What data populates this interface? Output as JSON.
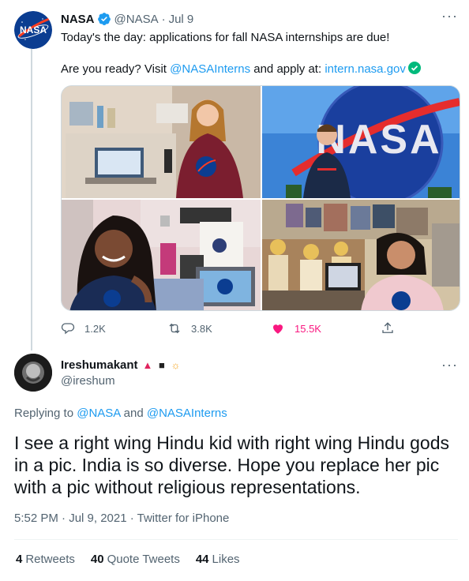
{
  "tweet": {
    "author_name": "NASA",
    "handle": "@NASA",
    "date": "Jul 9",
    "text_line1": "Today's the day: applications for fall NASA internships are due!",
    "text_line2_prefix": "Are you ready? Visit ",
    "mention": "@NASAInterns",
    "text_line2_mid": " and apply at: ",
    "link": "intern.nasa.gov",
    "actions": {
      "replies": "1.2K",
      "retweets": "3.8K",
      "likes": "15.5K"
    },
    "avatar_text": "NASA"
  },
  "reply": {
    "author_name": "Ireshumakant",
    "handle": "@ireshum",
    "name_emojis": "▲ ■ ☼",
    "replying_prefix": "Replying to ",
    "replying_to_1": "@NASA",
    "replying_and": " and ",
    "replying_to_2": "@NASAInterns",
    "body": "I see a right wing Hindu kid with right wing Hindu gods in a pic. India is so diverse. Hope you replace her pic with a pic without religious representations.",
    "meta": "5:52 PM · Jul 9, 2021 · Twitter for iPhone",
    "stats": {
      "retweets_count": "4",
      "retweets_label": "Retweets",
      "quotes_count": "40",
      "quotes_label": "Quote Tweets",
      "likes_count": "44",
      "likes_label": "Likes"
    }
  },
  "colors": {
    "accent": "#1d9bf0",
    "like": "#f91880",
    "muted": "#536471",
    "verified_green": "#00ba7c"
  }
}
